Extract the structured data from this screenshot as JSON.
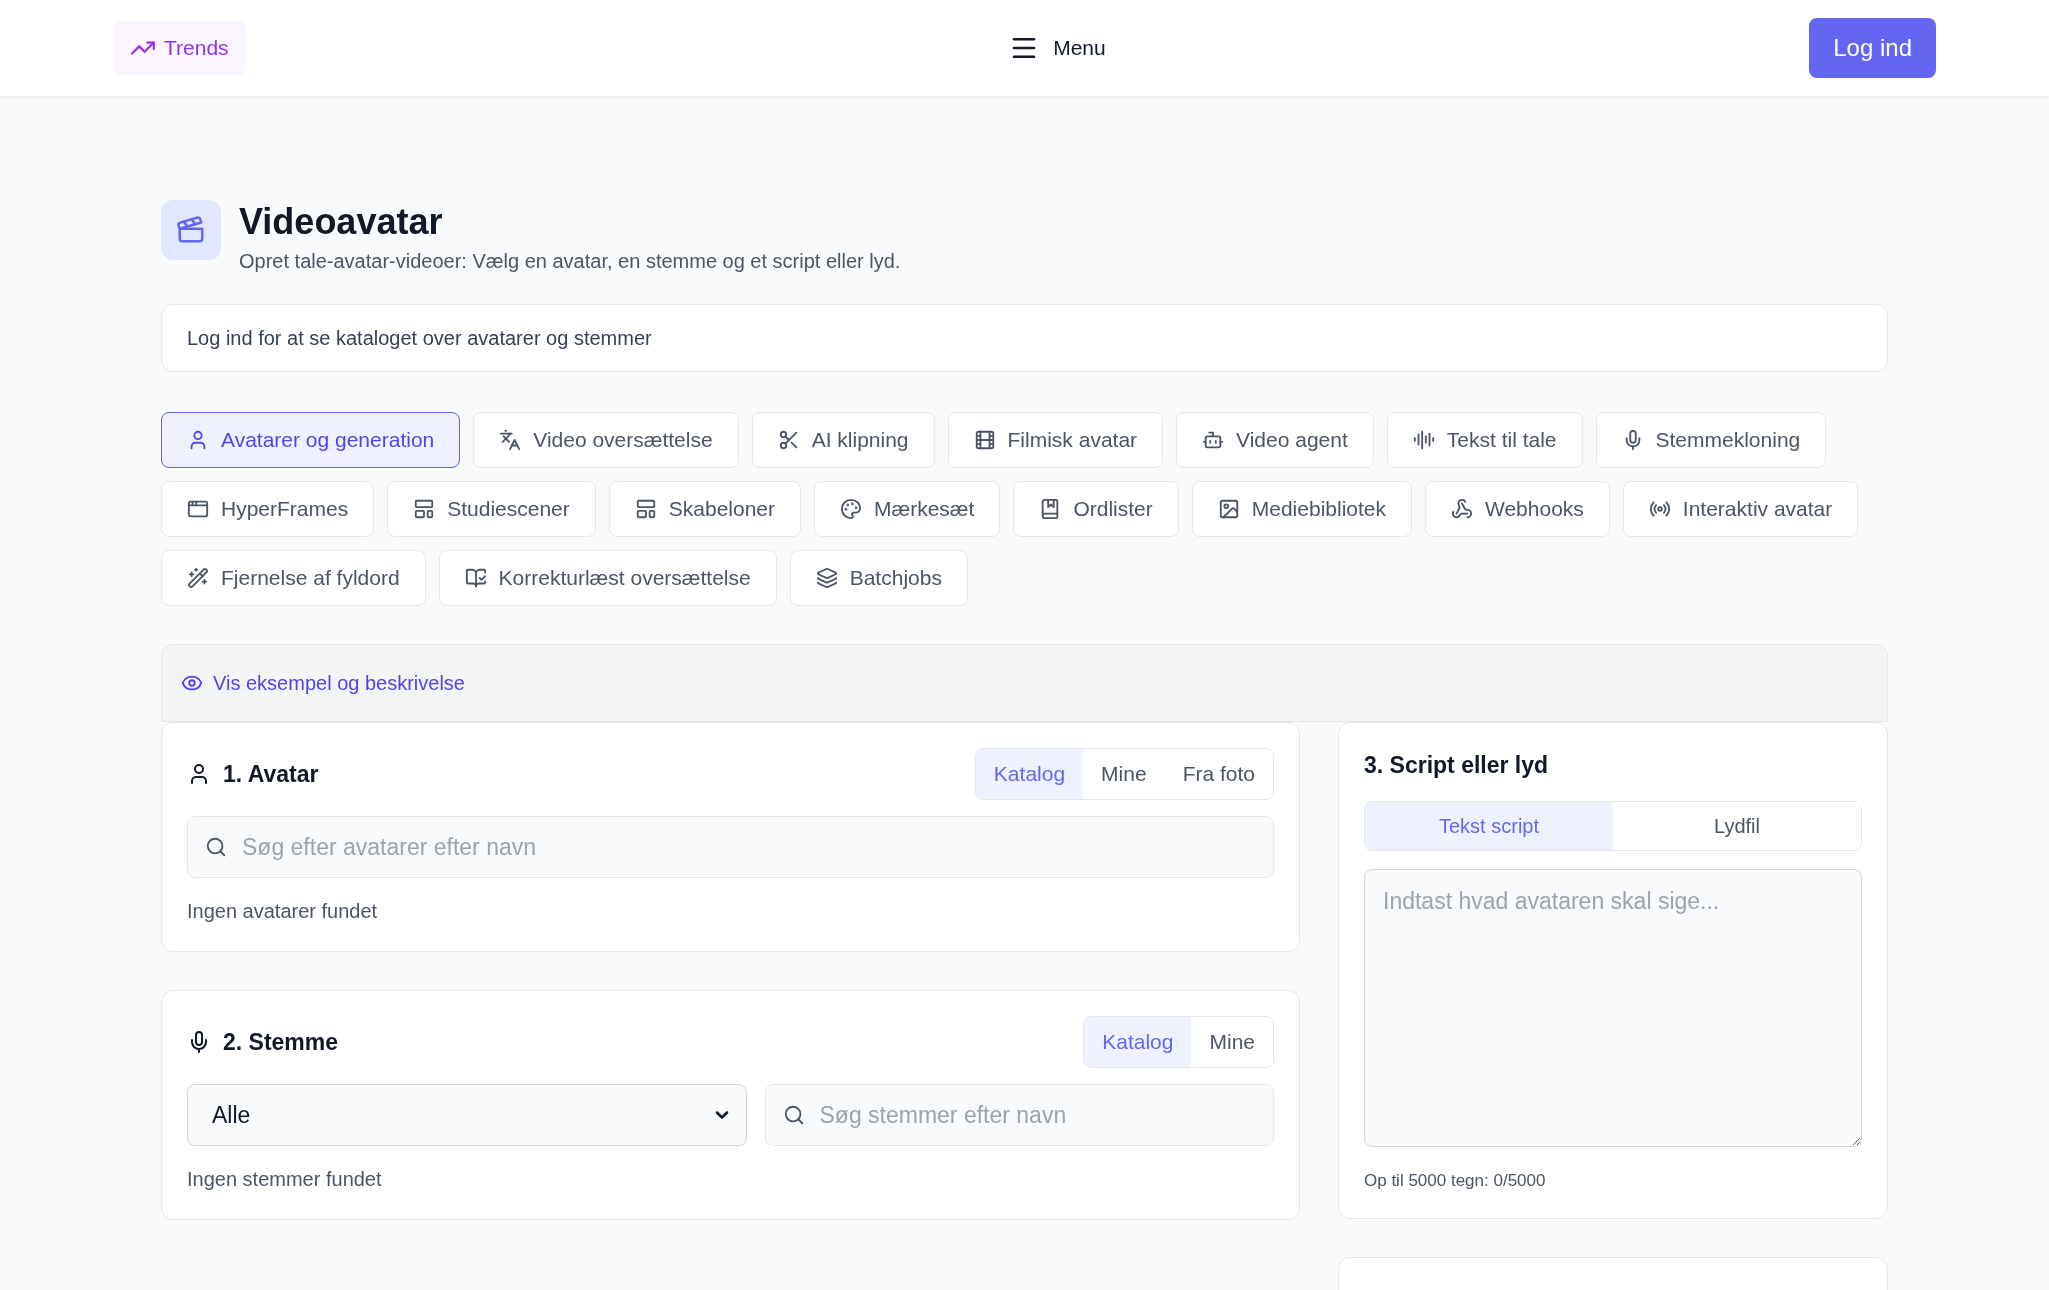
{
  "header": {
    "trends_button": "Trends",
    "menu_button": "Menu",
    "login_button": "Log ind"
  },
  "page": {
    "title": "Videoavatar",
    "subtitle": "Opret tale-avatar-videoer: Vælg en avatar, en stemme og et script eller lyd."
  },
  "notice": "Log ind for at se kataloget over avatarer og stemmer",
  "tabs": [
    {
      "label": "Avatarer og generation",
      "selected": true
    },
    {
      "label": "Video oversættelse",
      "selected": false
    },
    {
      "label": "AI klipning",
      "selected": false
    },
    {
      "label": "Filmisk avatar",
      "selected": false
    },
    {
      "label": "Video agent",
      "selected": false
    },
    {
      "label": "Tekst til tale",
      "selected": false
    },
    {
      "label": "Stemmekloning",
      "selected": false
    },
    {
      "label": "HyperFrames",
      "selected": false
    },
    {
      "label": "Studiescener",
      "selected": false
    },
    {
      "label": "Skabeloner",
      "selected": false
    },
    {
      "label": "Mærkesæt",
      "selected": false
    },
    {
      "label": "Ordlister",
      "selected": false
    },
    {
      "label": "Mediebibliotek",
      "selected": false
    },
    {
      "label": "Webhooks",
      "selected": false
    },
    {
      "label": "Interaktiv avatar",
      "selected": false
    },
    {
      "label": "Fjernelse af fyldord",
      "selected": false
    },
    {
      "label": "Korrekturlæst oversættelse",
      "selected": false
    },
    {
      "label": "Batchjobs",
      "selected": false
    }
  ],
  "preview_link": "Vis eksempel og beskrivelse",
  "avatar_card": {
    "title": "1. Avatar",
    "segments": [
      {
        "label": "Katalog",
        "selected": true
      },
      {
        "label": "Mine",
        "selected": false
      },
      {
        "label": "Fra foto",
        "selected": false
      }
    ],
    "search": {
      "placeholder": "Søg efter avatarer efter navn"
    },
    "empty": "Ingen avatarer fundet"
  },
  "voice_card": {
    "title": "2. Stemme",
    "segments": [
      {
        "label": "Katalog",
        "selected": true
      },
      {
        "label": "Mine",
        "selected": false
      }
    ],
    "filter": {
      "value": "Alle"
    },
    "search": {
      "placeholder": "Søg stemmer efter navn"
    },
    "empty": "Ingen stemmer fundet"
  },
  "script_card": {
    "title": "3. Script eller lyd",
    "tabs": [
      {
        "label": "Tekst script",
        "selected": true
      },
      {
        "label": "Lydfil",
        "selected": false
      }
    ],
    "textarea": {
      "placeholder": "Indtast hvad avataren skal sige..."
    },
    "counter": "Op til 5000 tegn: 0/5000"
  }
}
